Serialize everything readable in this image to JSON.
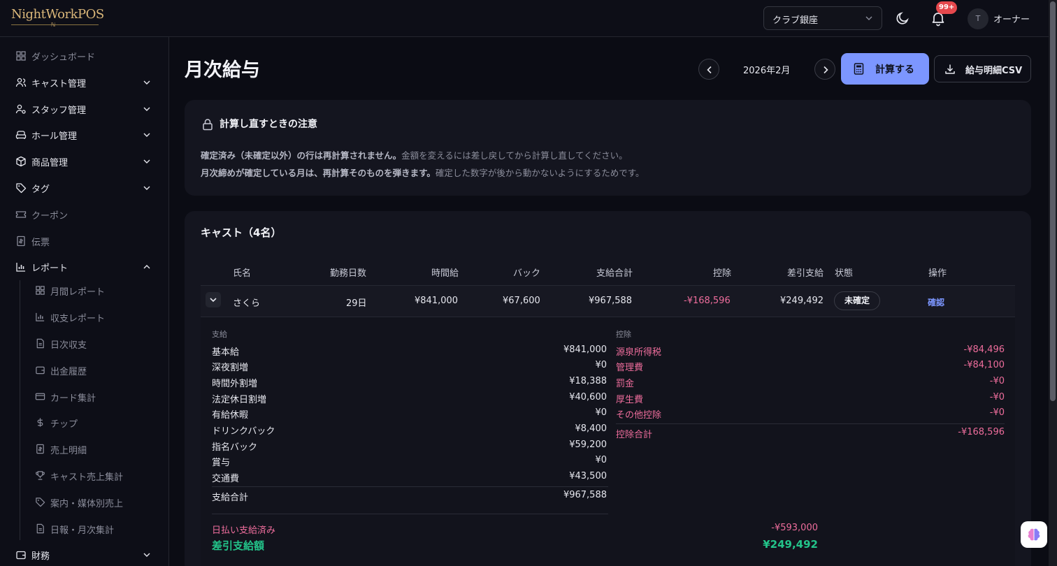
{
  "app": {
    "logo_text": "NightWorkPOS",
    "logo_mark": "ℕ"
  },
  "header": {
    "store_selected": "クラブ銀座",
    "notification_badge": "99+",
    "avatar_initial": "T",
    "user_name": "オーナー"
  },
  "sidebar": {
    "items": [
      {
        "label": "ダッシュボード",
        "icon": "grid-icon"
      },
      {
        "label": "キャスト管理",
        "icon": "users-icon"
      },
      {
        "label": "スタッフ管理",
        "icon": "user-gear-icon"
      },
      {
        "label": "ホール管理",
        "icon": "sofa-icon"
      },
      {
        "label": "商品管理",
        "icon": "box-icon"
      },
      {
        "label": "タグ",
        "icon": "tag-icon"
      },
      {
        "label": "クーポン",
        "icon": "ticket-icon"
      },
      {
        "label": "伝票",
        "icon": "receipt-icon"
      },
      {
        "label": "レポート",
        "icon": "bar-chart-icon"
      },
      {
        "label": "財務",
        "icon": "wallet-icon"
      }
    ],
    "report_subitems": [
      {
        "label": "月間レポート",
        "icon": "grid-icon"
      },
      {
        "label": "収支レポート",
        "icon": "bar-chart-icon"
      },
      {
        "label": "日次収支",
        "icon": "file-icon"
      },
      {
        "label": "出金履歴",
        "icon": "wallet-icon"
      },
      {
        "label": "カード集計",
        "icon": "card-icon"
      },
      {
        "label": "チップ",
        "icon": "dollar-icon"
      },
      {
        "label": "売上明細",
        "icon": "receipt-icon"
      },
      {
        "label": "キャスト売上集計",
        "icon": "trophy-icon"
      },
      {
        "label": "案内・媒体別売上",
        "icon": "tag-icon"
      },
      {
        "label": "日報・月次集計",
        "icon": "file-icon"
      }
    ]
  },
  "main": {
    "page_title": "月次給与",
    "month": "2026年2月",
    "calc_button": "計算する",
    "csv_button": "給与明細CSV"
  },
  "notice": {
    "title": "計算し直すときの注意",
    "line1_bold": "確定済み（未確定以外）の行は再計算されません。",
    "line1_rest": "金額を変えるには差し戻してから計算し直してください。",
    "line2_bold": "月次締めが確定している月は、再計算そのものを弾きます。",
    "line2_rest": "確定した数字が後から動かないようにするためです。"
  },
  "cast_table": {
    "title": "キャスト（4名）",
    "headers": [
      "氏名",
      "勤務日数",
      "時間給",
      "バック",
      "支給合計",
      "控除",
      "差引支給",
      "状態",
      "操作"
    ],
    "rows": [
      {
        "name": "さくら",
        "days": "29日",
        "hourly": "¥841,000",
        "back": "¥67,600",
        "gross": "¥967,588",
        "deduction": "-¥168,596",
        "net": "¥249,492",
        "status": "未確定",
        "action": "確認"
      }
    ]
  },
  "detail": {
    "pay_label": "支給",
    "pay_items": [
      {
        "k": "基本給",
        "v": "¥841,000"
      },
      {
        "k": "深夜割増",
        "v": "¥0"
      },
      {
        "k": "時間外割増",
        "v": "¥18,388"
      },
      {
        "k": "法定休日割増",
        "v": "¥40,600"
      },
      {
        "k": "有給休暇",
        "v": "¥0"
      },
      {
        "k": "ドリンクバック",
        "v": "¥8,400"
      },
      {
        "k": "指名バック",
        "v": "¥59,200"
      },
      {
        "k": "賞与",
        "v": "¥0"
      },
      {
        "k": "交通費",
        "v": "¥43,500"
      }
    ],
    "pay_total": {
      "k": "支給合計",
      "v": "¥967,588"
    },
    "daily_paid": {
      "k": "日払い支給済み",
      "v": "-¥593,000"
    },
    "net_pay": {
      "k": "差引支給額",
      "v": "¥249,492"
    },
    "deduct_label": "控除",
    "deduct_items": [
      {
        "k": "源泉所得税",
        "v": "-¥84,496"
      },
      {
        "k": "管理費",
        "v": "-¥84,100"
      },
      {
        "k": "罰金",
        "v": "-¥0"
      },
      {
        "k": "厚生費",
        "v": "-¥0"
      },
      {
        "k": "その他控除",
        "v": "-¥0"
      }
    ],
    "deduct_total": {
      "k": "控除合計",
      "v": "-¥168,596"
    }
  },
  "colors": {
    "accent": "#7c96ff",
    "deduction": "#ee6d9c",
    "net": "#23c48a",
    "background": "#0b0c14",
    "card": "#14151f"
  }
}
